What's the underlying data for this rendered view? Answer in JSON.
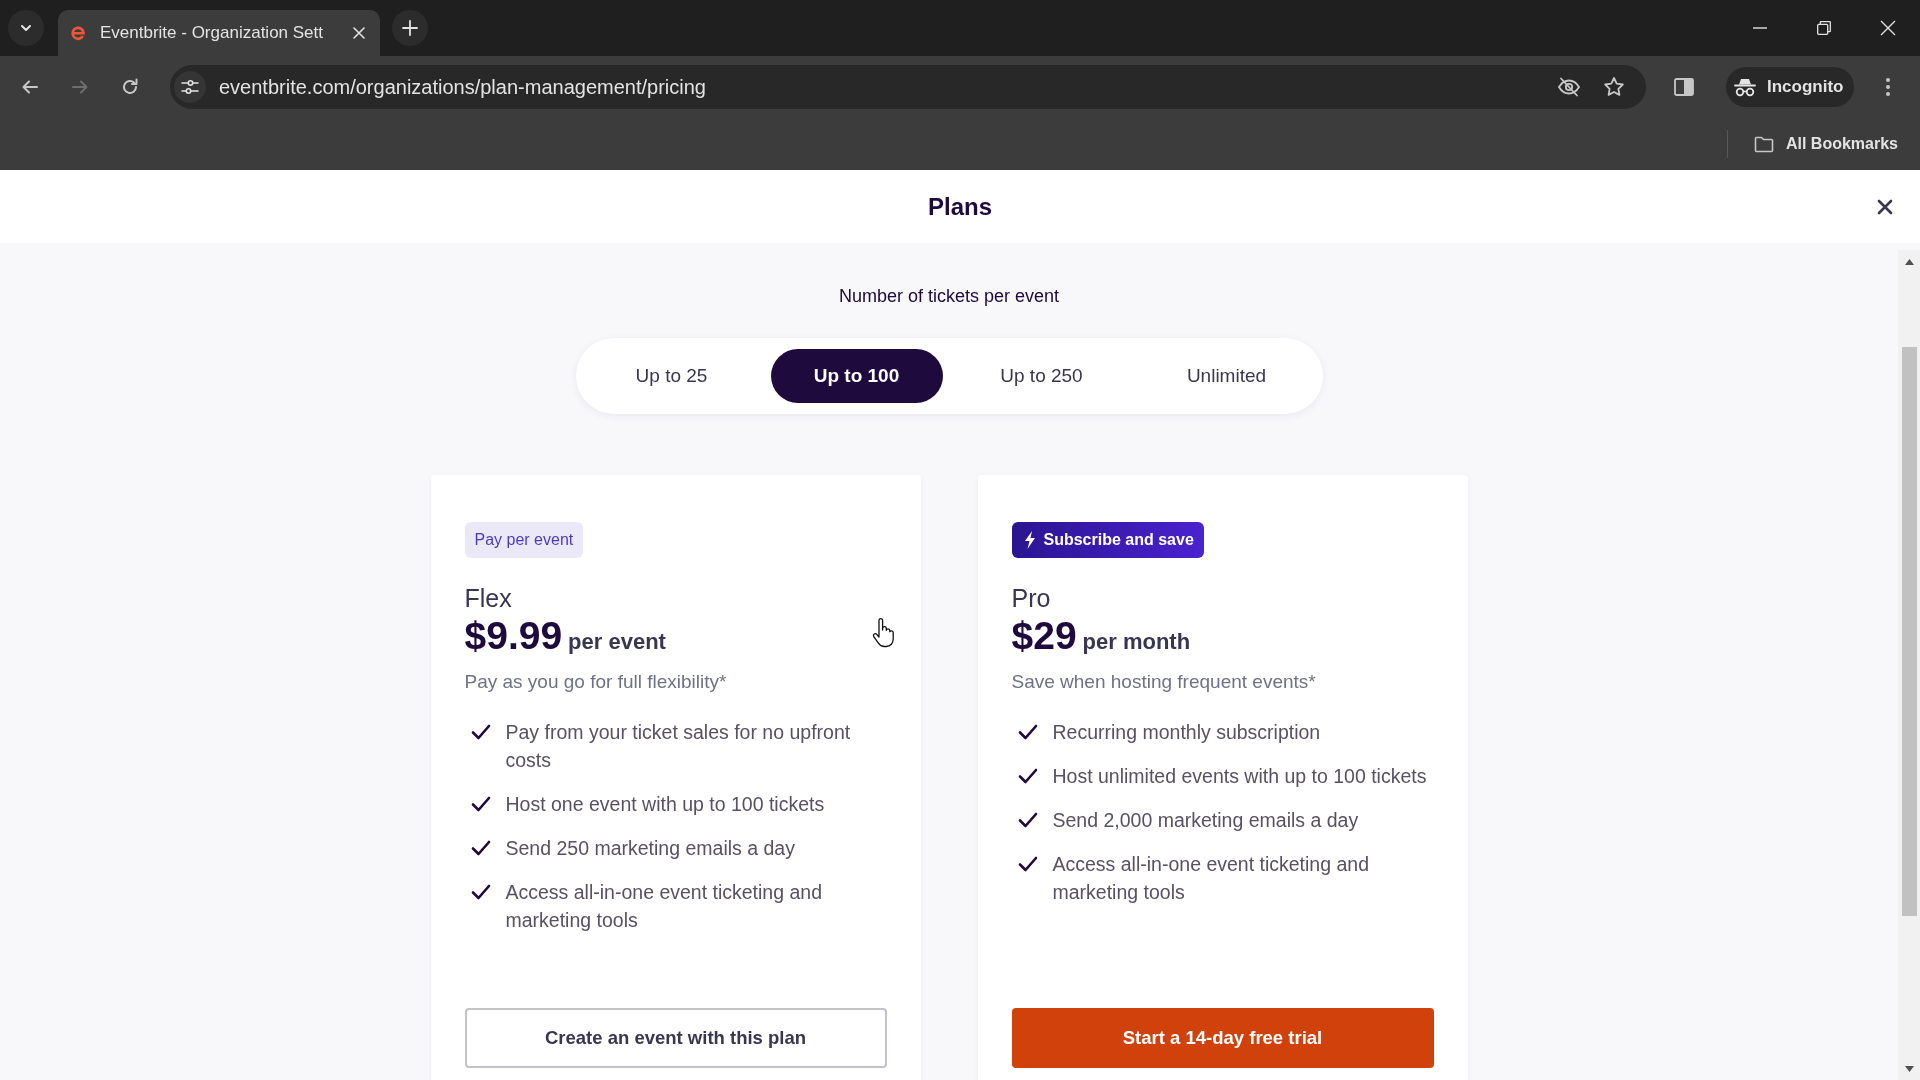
{
  "browser": {
    "tabs": [
      {
        "title": "Eventbrite - Organization Sett",
        "selected": true
      }
    ],
    "nav_buttons": [
      {
        "kind": "back",
        "disabled": false
      },
      {
        "kind": "forward",
        "disabled": true
      },
      {
        "kind": "reload",
        "disabled": false
      }
    ],
    "address_bar": {
      "url": "eventbrite.com/organizations/plan-management/pricing"
    },
    "profile_label": "Incognito",
    "bookmarks": [
      {
        "label": "All Bookmarks"
      }
    ]
  },
  "dialog": {
    "title": "Plans",
    "ticket_selector": {
      "label": "Number of tickets per event",
      "options": [
        {
          "label": "Up to 25",
          "selected": false
        },
        {
          "label": "Up to 100",
          "selected": true
        },
        {
          "label": "Up to 250",
          "selected": false
        },
        {
          "label": "Unlimited",
          "selected": false
        }
      ]
    },
    "plans": [
      {
        "kind": "standard",
        "badge": "Pay per event",
        "name": "Flex",
        "price": "$9.99",
        "period": "per event",
        "description": "Pay as you go for full flexibility*",
        "features": [
          "Pay from your ticket sales for no upfront costs",
          "Host one event with up to 100 tickets",
          "Send 250 marketing emails a day",
          "Access all-in-one event ticketing and marketing tools"
        ],
        "button": "Create an event with this plan"
      },
      {
        "kind": "featured",
        "badge": "Subscribe and save",
        "name": "Pro",
        "price": "$29",
        "period": "per month",
        "description": "Save when hosting frequent events*",
        "features": [
          "Recurring monthly subscription",
          "Host unlimited events with up to 100 tickets",
          "Send 2,000 marketing emails a day",
          "Access all-in-one event ticketing and marketing tools"
        ],
        "button": "Start a 14-day free trial"
      }
    ]
  }
}
